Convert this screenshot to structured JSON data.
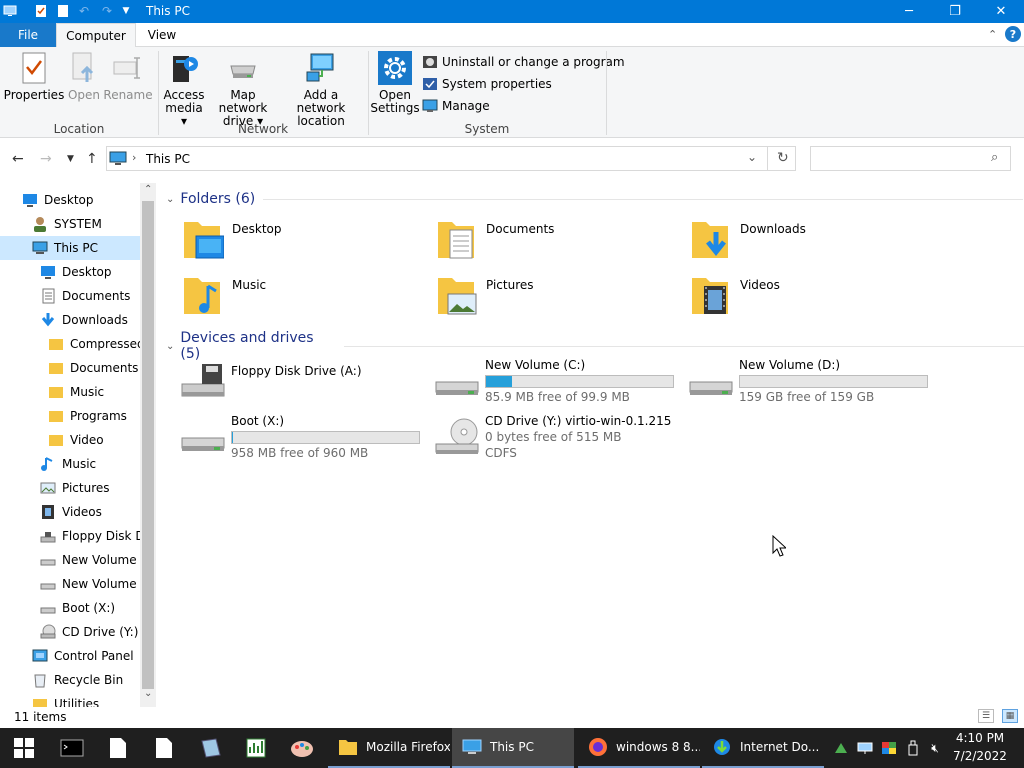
{
  "window": {
    "title": "This PC"
  },
  "tabs": {
    "file": "File",
    "computer": "Computer",
    "view": "View"
  },
  "ribbon": {
    "properties": "Properties",
    "open": "Open",
    "rename": "Rename",
    "access_media": "Access",
    "access_media2": "media ▾",
    "map_drive": "Map network",
    "map_drive2": "drive ▾",
    "add_location": "Add a network",
    "add_location2": "location",
    "open_settings": "Open",
    "open_settings2": "Settings",
    "uninstall": "Uninstall or change a program",
    "system_properties": "System properties",
    "manage": "Manage",
    "group_location": "Location",
    "group_network": "Network",
    "group_system": "System"
  },
  "address": {
    "path": "This PC"
  },
  "nav": [
    {
      "label": "Desktop",
      "icon": "desktop-icon"
    },
    {
      "label": "SYSTEM",
      "icon": "user-icon"
    },
    {
      "label": "This PC",
      "icon": "pc-icon"
    },
    {
      "label": "Desktop",
      "icon": "desktop-icon"
    },
    {
      "label": "Documents",
      "icon": "documents-icon"
    },
    {
      "label": "Downloads",
      "icon": "downloads-icon"
    },
    {
      "label": "Compressed",
      "icon": "folder-icon"
    },
    {
      "label": "Documents",
      "icon": "folder-icon"
    },
    {
      "label": "Music",
      "icon": "folder-icon"
    },
    {
      "label": "Programs",
      "icon": "folder-icon"
    },
    {
      "label": "Video",
      "icon": "folder-icon"
    },
    {
      "label": "Music",
      "icon": "music-icon"
    },
    {
      "label": "Pictures",
      "icon": "pictures-icon"
    },
    {
      "label": "Videos",
      "icon": "videos-icon"
    },
    {
      "label": "Floppy Disk Dri",
      "icon": "floppy-icon"
    },
    {
      "label": "New Volume (C",
      "icon": "drive-icon"
    },
    {
      "label": "New Volume (D",
      "icon": "drive-icon"
    },
    {
      "label": "Boot (X:)",
      "icon": "drive-icon"
    },
    {
      "label": "CD Drive (Y:) vi",
      "icon": "cd-icon"
    },
    {
      "label": "Control Panel",
      "icon": "control-panel-icon"
    },
    {
      "label": "Recycle Bin",
      "icon": "recycle-bin-icon"
    },
    {
      "label": "Utilities",
      "icon": "folder-icon"
    }
  ],
  "folders": {
    "header": "Folders (6)",
    "items": [
      "Desktop",
      "Documents",
      "Downloads",
      "Music",
      "Pictures",
      "Videos"
    ]
  },
  "drives": {
    "header": "Devices and drives (5)",
    "items": [
      {
        "name": "Floppy Disk Drive (A:)"
      },
      {
        "name": "New Volume (C:)",
        "free": "85.9 MB free of 99.9 MB",
        "used_fraction": 0.14
      },
      {
        "name": "New Volume (D:)",
        "free": "159 GB free of 159 GB",
        "used_fraction": 0.0
      },
      {
        "name": "Boot (X:)",
        "free": "958 MB free of 960 MB",
        "used_fraction": 0.002
      },
      {
        "name": "CD Drive (Y:) virtio-win-0.1.215",
        "free": "0 bytes free of 515 MB",
        "fs": "CDFS"
      }
    ]
  },
  "status": {
    "items": "11 items"
  },
  "taskbar": {
    "windows": [
      {
        "label": "Mozilla Firefox"
      },
      {
        "label": "This PC"
      },
      {
        "label": "windows 8 8..."
      },
      {
        "label": "Internet Do..."
      }
    ],
    "time": "4:10 PM",
    "date": "7/2/2022"
  },
  "colors": {
    "accent": "#0078d7",
    "selection": "#cce8ff",
    "bar_fill": "#26a0da",
    "folder": "#f5c542"
  }
}
